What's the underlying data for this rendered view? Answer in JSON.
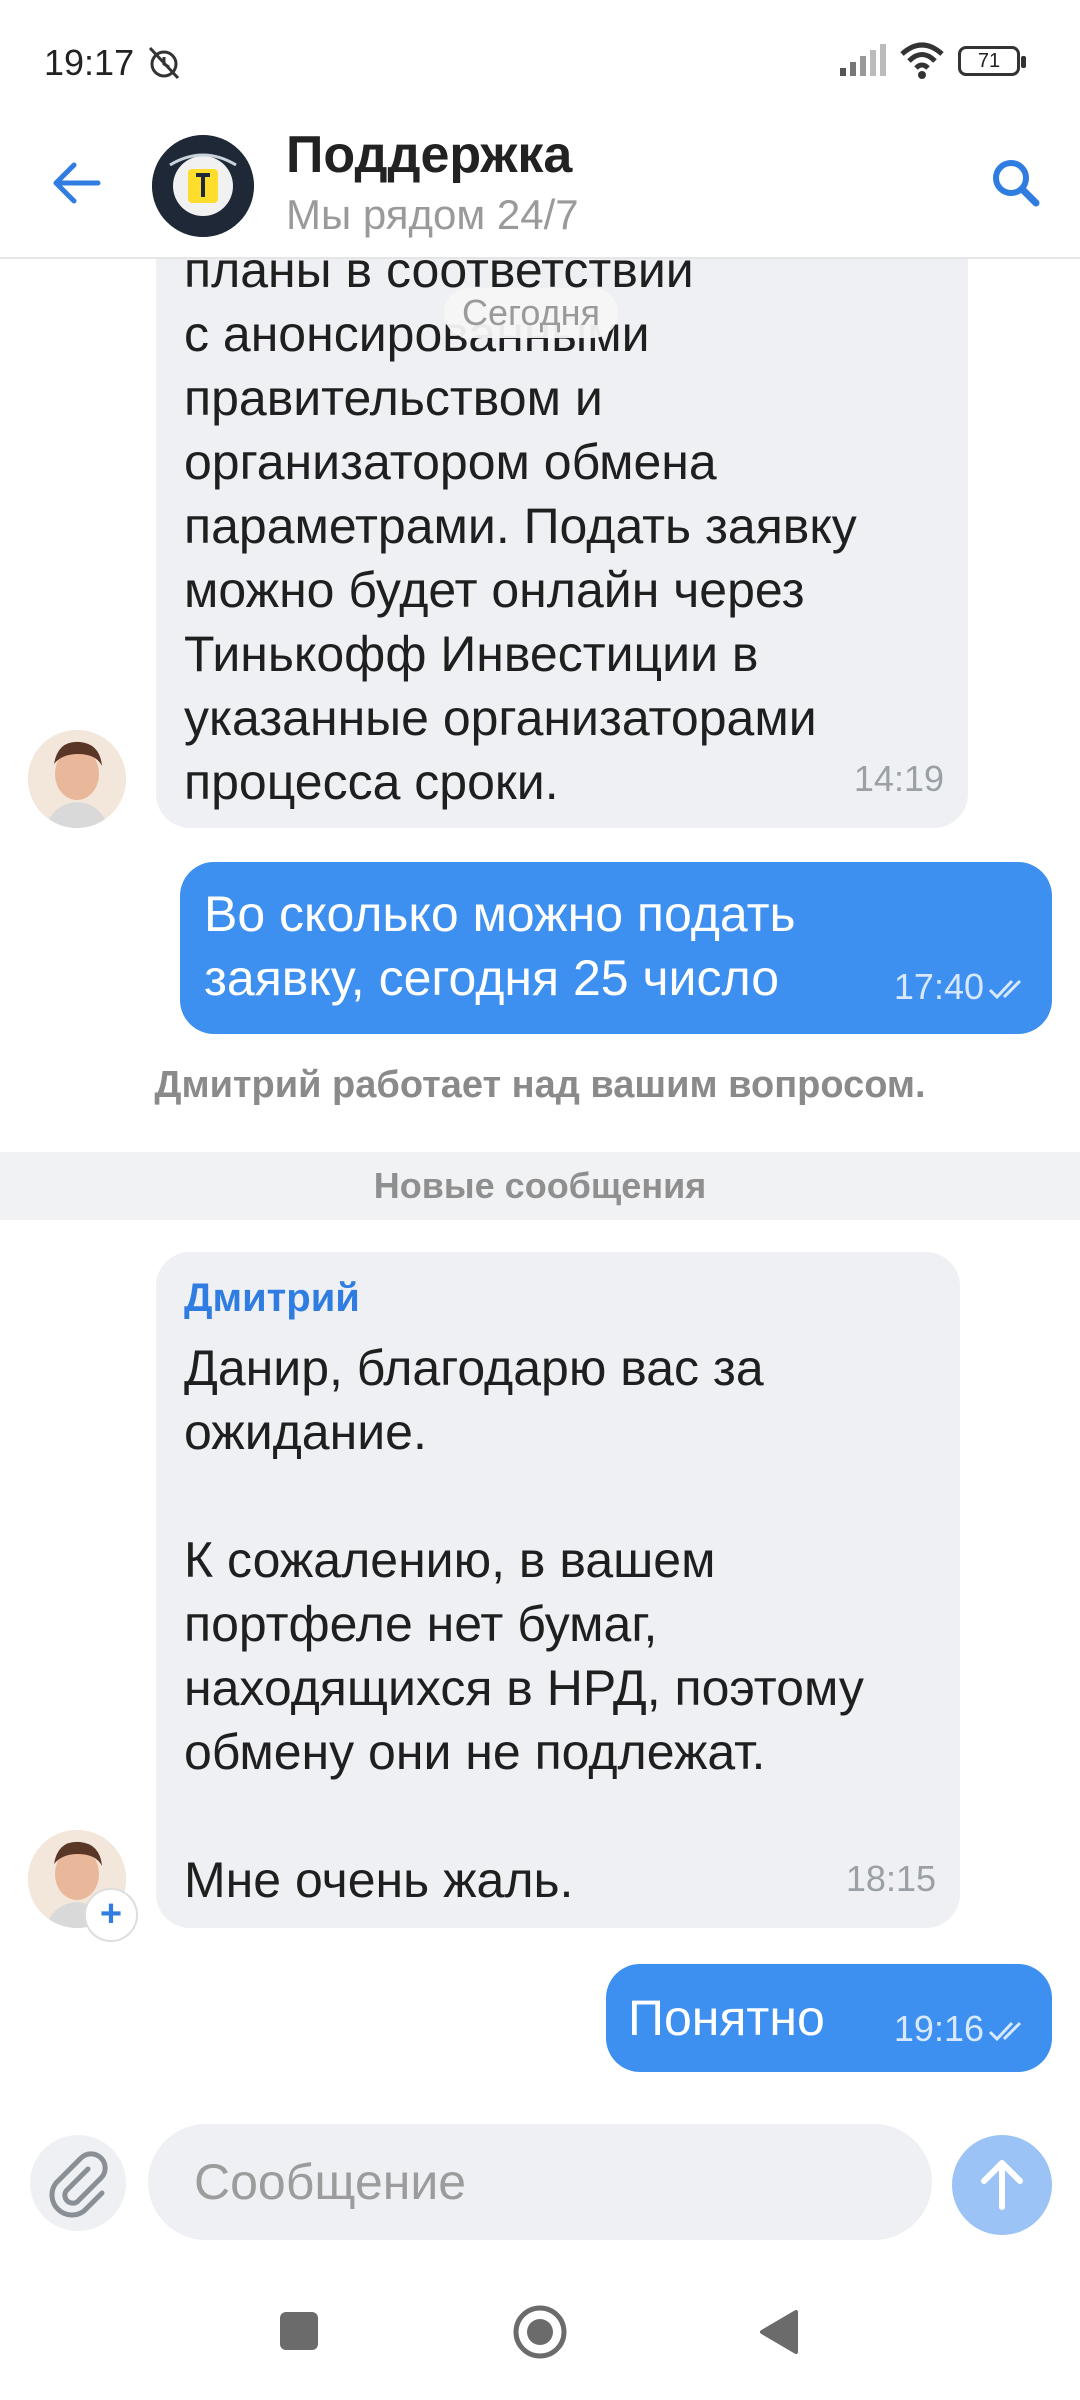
{
  "status_bar": {
    "time": "19:17",
    "battery": "71"
  },
  "header": {
    "title": "Поддержка",
    "subtitle": "Мы рядом 24/7"
  },
  "date_separator": "Сегодня",
  "messages": [
    {
      "direction": "in",
      "text": "планы в соответствии\nс анонсированными\nправительством и\nорганизатором обмена\nпараметрами. Подать заявку\nможно будет онлайн через\nТинькофф Инвестиции в\nуказанные организаторами\nпроцесса сроки.",
      "time": "14:19"
    },
    {
      "direction": "out",
      "text": "Во сколько можно подать\nзаявку, сегодня 25 число",
      "time": "17:40"
    },
    {
      "direction": "in",
      "sender": "Дмитрий",
      "text": "Данир, благодарю вас за\nожидание.\n\nК сожалению, в вашем\nпортфеле нет бумаг,\nнаходящихся в НРД, поэтому\nобмену они не подлежат.\n\nМне очень жаль.",
      "time": "18:15"
    },
    {
      "direction": "out",
      "text": "Понятно",
      "time": "19:16"
    }
  ],
  "agent_status": "Дмитрий работает над вашим вопросом.",
  "new_messages_label": "Новые сообщения",
  "composer": {
    "placeholder": "Сообщение"
  },
  "colors": {
    "accent": "#3d8ff0",
    "incoming_bubble": "#eef0f3",
    "send_disabled": "#9cc3f5"
  }
}
